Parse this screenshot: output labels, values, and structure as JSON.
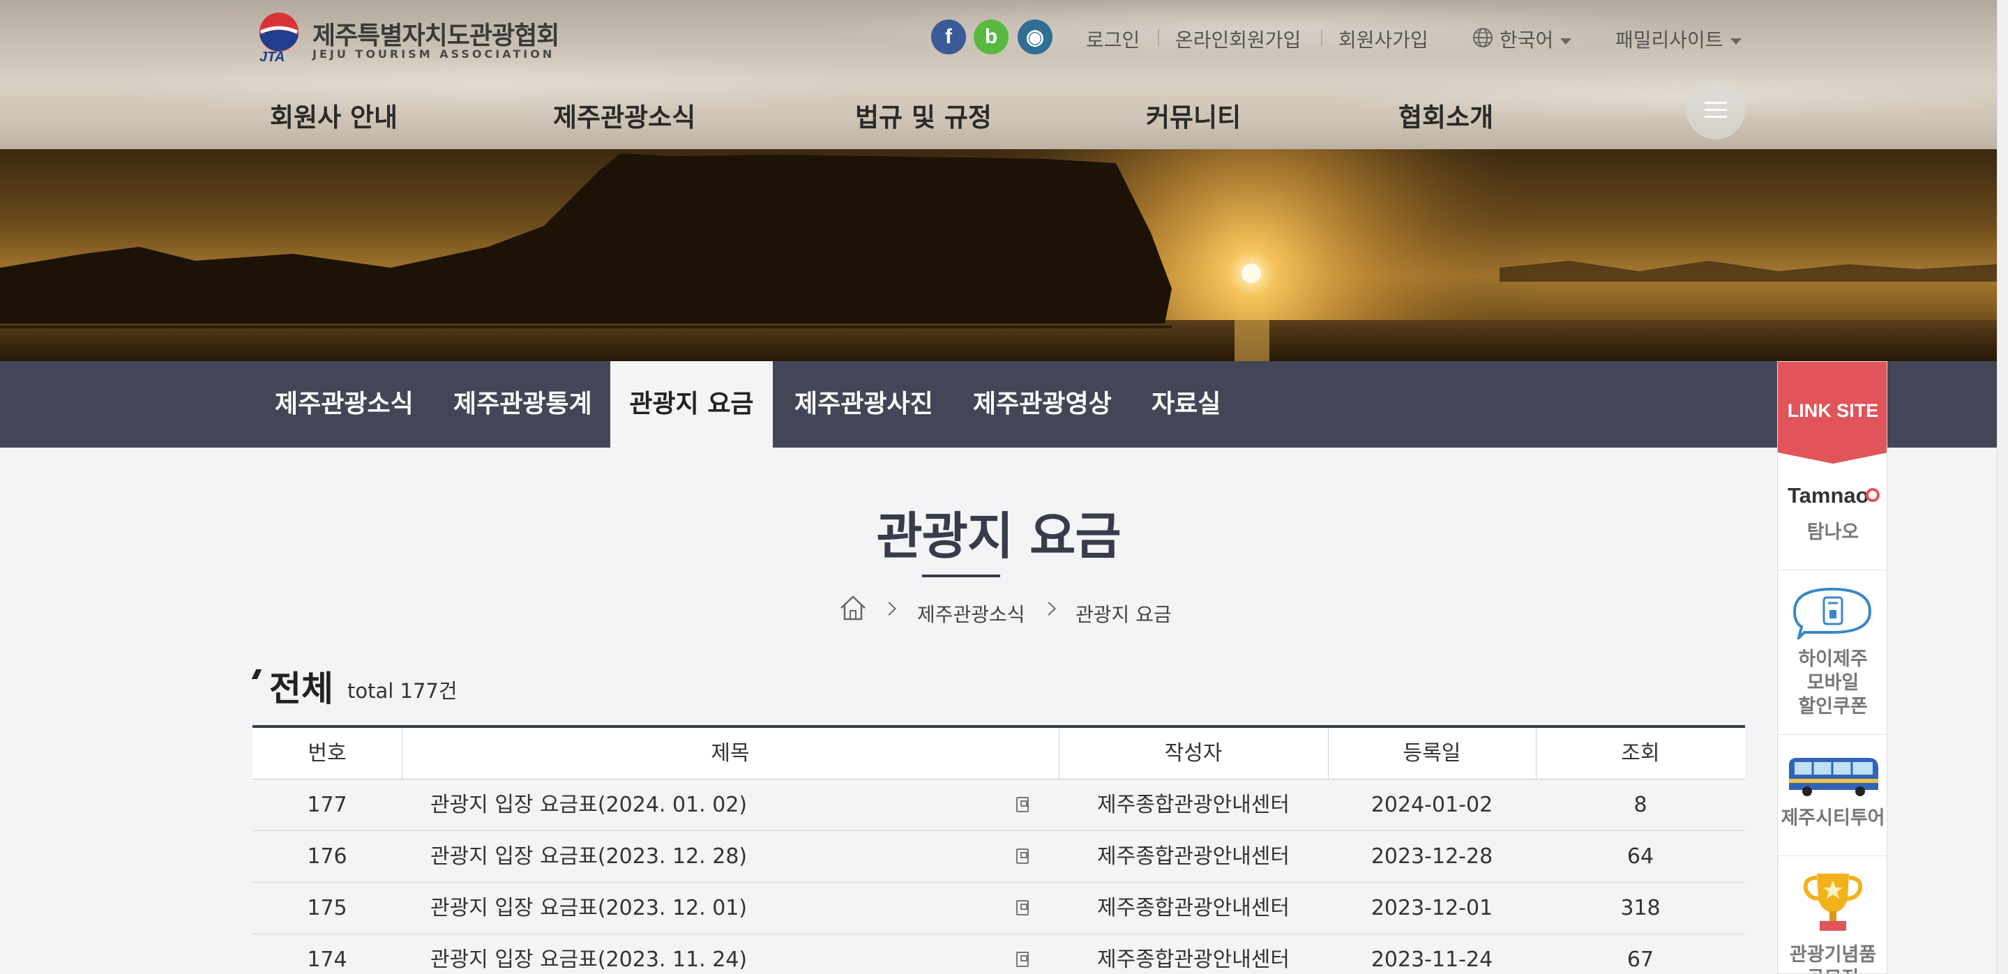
{
  "header": {
    "logo": {
      "kr": "제주특별자치도관광협회",
      "en": "JEJU TOURISM ASSOCIATION",
      "mark_text": "JTA"
    },
    "social": [
      {
        "name": "facebook",
        "glyph": "f"
      },
      {
        "name": "blog",
        "glyph": "b"
      },
      {
        "name": "instagram",
        "glyph": "◉"
      }
    ],
    "links": {
      "login": "로그인",
      "online_join": "온라인회원가입",
      "member_join": "회원사가입",
      "language": "한국어",
      "family": "패밀리사이트"
    },
    "gnb": [
      "회원사 안내",
      "제주관광소식",
      "법규 및 규정",
      "커뮤니티",
      "협회소개"
    ]
  },
  "subnav": [
    "제주관광소식",
    "제주관광통계",
    "관광지 요금",
    "제주관광사진",
    "제주관광영상",
    "자료실"
  ],
  "page": {
    "title": "관광지 요금",
    "breadcrumb": [
      "제주관광소식",
      "관광지 요금"
    ],
    "section_title": "전체",
    "total": "total 177건"
  },
  "table": {
    "headers": [
      "번호",
      "제목",
      "작성자",
      "등록일",
      "조회"
    ],
    "rows": [
      {
        "no": "177",
        "title": "관광지 입장 요금표(2024. 01. 02)",
        "author": "제주종합관광안내센터",
        "date": "2024-01-02",
        "views": "8"
      },
      {
        "no": "176",
        "title": "관광지 입장 요금표(2023. 12. 28)",
        "author": "제주종합관광안내센터",
        "date": "2023-12-28",
        "views": "64"
      },
      {
        "no": "175",
        "title": "관광지 입장 요금표(2023. 12. 01)",
        "author": "제주종합관광안내센터",
        "date": "2023-12-01",
        "views": "318"
      },
      {
        "no": "174",
        "title": "관광지 입장 요금표(2023. 11. 24)",
        "author": "제주종합관광안내센터",
        "date": "2023-11-24",
        "views": "67"
      }
    ]
  },
  "linksite": {
    "title": "LINK SITE",
    "tamnao_logo": "Tamnao",
    "items": [
      "탐나오",
      "하이제주\n모바일\n할인쿠폰",
      "제주시티투어",
      "관광기념품\n공모전"
    ]
  },
  "colors": {
    "subnav_bg": "#434656",
    "linksite_red": "#e0545a",
    "title_color": "#383c4a"
  }
}
